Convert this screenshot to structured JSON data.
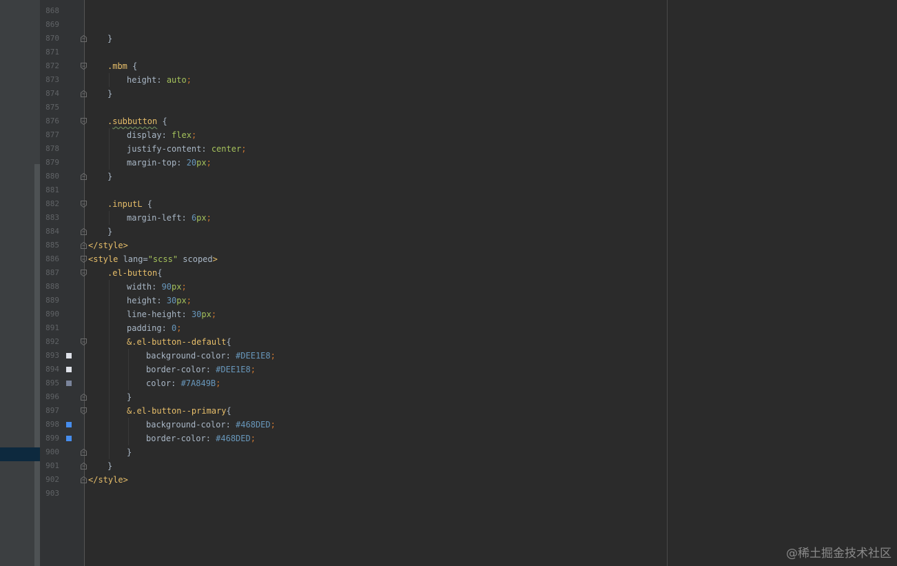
{
  "editor": {
    "lines": [
      {
        "num": "868",
        "indent": 0,
        "tokens": []
      },
      {
        "num": "869",
        "indent": 0,
        "tokens": []
      },
      {
        "num": "870",
        "indent": 1,
        "fold": "end",
        "tokens": [
          {
            "t": "}",
            "c": "plain"
          }
        ]
      },
      {
        "num": "871",
        "indent": 0,
        "tokens": []
      },
      {
        "num": "872",
        "indent": 1,
        "fold": "start",
        "tokens": [
          {
            "t": ".mbm",
            "c": "sel"
          },
          {
            "t": " {",
            "c": "plain"
          }
        ]
      },
      {
        "num": "873",
        "indent": 2,
        "tokens": [
          {
            "t": "height",
            "c": "prop"
          },
          {
            "t": ": ",
            "c": "plain"
          },
          {
            "t": "auto",
            "c": "kw"
          },
          {
            "t": ";",
            "c": "punc"
          }
        ]
      },
      {
        "num": "874",
        "indent": 1,
        "fold": "end",
        "tokens": [
          {
            "t": "}",
            "c": "plain"
          }
        ]
      },
      {
        "num": "875",
        "indent": 0,
        "tokens": []
      },
      {
        "num": "876",
        "indent": 1,
        "fold": "start",
        "tokens": [
          {
            "t": ".",
            "c": "sel"
          },
          {
            "t": "subbutton",
            "c": "sel",
            "wavy": true
          },
          {
            "t": " {",
            "c": "plain"
          }
        ]
      },
      {
        "num": "877",
        "indent": 2,
        "tokens": [
          {
            "t": "display",
            "c": "prop"
          },
          {
            "t": ": ",
            "c": "plain"
          },
          {
            "t": "flex",
            "c": "kw"
          },
          {
            "t": ";",
            "c": "punc"
          }
        ]
      },
      {
        "num": "878",
        "indent": 2,
        "tokens": [
          {
            "t": "justify-content",
            "c": "prop"
          },
          {
            "t": ": ",
            "c": "plain"
          },
          {
            "t": "center",
            "c": "kw"
          },
          {
            "t": ";",
            "c": "punc"
          }
        ]
      },
      {
        "num": "879",
        "indent": 2,
        "tokens": [
          {
            "t": "margin-top",
            "c": "prop"
          },
          {
            "t": ": ",
            "c": "plain"
          },
          {
            "t": "20",
            "c": "num"
          },
          {
            "t": "px",
            "c": "kw"
          },
          {
            "t": ";",
            "c": "punc"
          }
        ]
      },
      {
        "num": "880",
        "indent": 1,
        "fold": "end",
        "tokens": [
          {
            "t": "}",
            "c": "plain"
          }
        ]
      },
      {
        "num": "881",
        "indent": 0,
        "tokens": []
      },
      {
        "num": "882",
        "indent": 1,
        "fold": "start",
        "tokens": [
          {
            "t": ".inputL",
            "c": "sel"
          },
          {
            "t": " {",
            "c": "plain"
          }
        ]
      },
      {
        "num": "883",
        "indent": 2,
        "tokens": [
          {
            "t": "margin-left",
            "c": "prop"
          },
          {
            "t": ": ",
            "c": "plain"
          },
          {
            "t": "6",
            "c": "num"
          },
          {
            "t": "px",
            "c": "kw"
          },
          {
            "t": ";",
            "c": "punc"
          }
        ]
      },
      {
        "num": "884",
        "indent": 1,
        "fold": "end",
        "tokens": [
          {
            "t": "}",
            "c": "plain"
          }
        ]
      },
      {
        "num": "885",
        "indent": 0,
        "fold": "end",
        "tokens": [
          {
            "t": "</style>",
            "c": "tag"
          }
        ]
      },
      {
        "num": "886",
        "indent": 0,
        "fold": "start",
        "tokens": [
          {
            "t": "<style ",
            "c": "tag"
          },
          {
            "t": "lang=",
            "c": "plain"
          },
          {
            "t": "\"scss\"",
            "c": "str"
          },
          {
            "t": " scoped",
            "c": "plain"
          },
          {
            "t": ">",
            "c": "tag"
          }
        ]
      },
      {
        "num": "887",
        "indent": 1,
        "fold": "start",
        "tokens": [
          {
            "t": ".el-button",
            "c": "sel"
          },
          {
            "t": "{",
            "c": "plain"
          }
        ]
      },
      {
        "num": "888",
        "indent": 2,
        "tokens": [
          {
            "t": "width",
            "c": "prop"
          },
          {
            "t": ": ",
            "c": "plain"
          },
          {
            "t": "90",
            "c": "num"
          },
          {
            "t": "px",
            "c": "kw"
          },
          {
            "t": ";",
            "c": "punc"
          }
        ]
      },
      {
        "num": "889",
        "indent": 2,
        "tokens": [
          {
            "t": "height",
            "c": "prop"
          },
          {
            "t": ": ",
            "c": "plain"
          },
          {
            "t": "30",
            "c": "num"
          },
          {
            "t": "px",
            "c": "kw"
          },
          {
            "t": ";",
            "c": "punc"
          }
        ]
      },
      {
        "num": "890",
        "indent": 2,
        "tokens": [
          {
            "t": "line-height",
            "c": "prop"
          },
          {
            "t": ": ",
            "c": "plain"
          },
          {
            "t": "30",
            "c": "num"
          },
          {
            "t": "px",
            "c": "kw"
          },
          {
            "t": ";",
            "c": "punc"
          }
        ]
      },
      {
        "num": "891",
        "indent": 2,
        "tokens": [
          {
            "t": "padding",
            "c": "prop"
          },
          {
            "t": ": ",
            "c": "plain"
          },
          {
            "t": "0",
            "c": "num"
          },
          {
            "t": ";",
            "c": "punc"
          }
        ]
      },
      {
        "num": "892",
        "indent": 2,
        "fold": "start",
        "tokens": [
          {
            "t": "&.el-button--default",
            "c": "sel"
          },
          {
            "t": "{",
            "c": "plain"
          }
        ]
      },
      {
        "num": "893",
        "indent": 3,
        "swatch": "#DEE1E8",
        "tokens": [
          {
            "t": "background-color",
            "c": "prop"
          },
          {
            "t": ": ",
            "c": "plain"
          },
          {
            "t": "#DEE1E8",
            "c": "hex"
          },
          {
            "t": ";",
            "c": "punc"
          }
        ]
      },
      {
        "num": "894",
        "indent": 3,
        "swatch": "#DEE1E8",
        "tokens": [
          {
            "t": "border-color",
            "c": "prop"
          },
          {
            "t": ": ",
            "c": "plain"
          },
          {
            "t": "#DEE1E8",
            "c": "hex"
          },
          {
            "t": ";",
            "c": "punc"
          }
        ]
      },
      {
        "num": "895",
        "indent": 3,
        "swatch": "#7A849B",
        "tokens": [
          {
            "t": "color",
            "c": "prop"
          },
          {
            "t": ": ",
            "c": "plain"
          },
          {
            "t": "#7A849B",
            "c": "hex"
          },
          {
            "t": ";",
            "c": "punc"
          }
        ]
      },
      {
        "num": "896",
        "indent": 2,
        "fold": "end",
        "tokens": [
          {
            "t": "}",
            "c": "plain"
          }
        ]
      },
      {
        "num": "897",
        "indent": 2,
        "fold": "start",
        "tokens": [
          {
            "t": "&.el-button--primary",
            "c": "sel"
          },
          {
            "t": "{",
            "c": "plain"
          }
        ]
      },
      {
        "num": "898",
        "indent": 3,
        "swatch": "#468DED",
        "tokens": [
          {
            "t": "background-color",
            "c": "prop"
          },
          {
            "t": ": ",
            "c": "plain"
          },
          {
            "t": "#468DED",
            "c": "hex"
          },
          {
            "t": ";",
            "c": "punc"
          }
        ]
      },
      {
        "num": "899",
        "indent": 3,
        "swatch": "#468DED",
        "tokens": [
          {
            "t": "border-color",
            "c": "prop"
          },
          {
            "t": ": ",
            "c": "plain"
          },
          {
            "t": "#468DED",
            "c": "hex"
          },
          {
            "t": ";",
            "c": "punc"
          }
        ]
      },
      {
        "num": "900",
        "indent": 2,
        "fold": "end",
        "tokens": [
          {
            "t": "}",
            "c": "plain"
          }
        ]
      },
      {
        "num": "901",
        "indent": 1,
        "fold": "end",
        "tokens": [
          {
            "t": "}",
            "c": "plain"
          }
        ]
      },
      {
        "num": "902",
        "indent": 0,
        "fold": "end",
        "tokens": [
          {
            "t": "</style>",
            "c": "tag"
          }
        ]
      },
      {
        "num": "903",
        "indent": 0,
        "tokens": []
      }
    ]
  },
  "watermark": "@稀土掘金技术社区",
  "colors": {
    "background": "#2b2b2b",
    "gutter": "#313335",
    "selector": "#e8bf6a",
    "keyword": "#a5c25c",
    "number": "#6897bb",
    "punctuation": "#cc7832"
  }
}
